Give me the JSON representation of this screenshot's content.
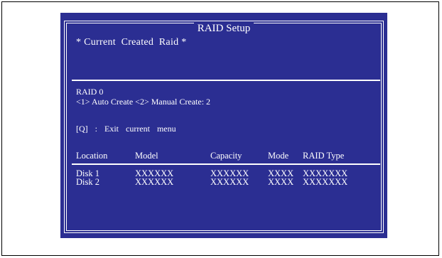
{
  "window": {
    "title": "RAID Setup",
    "subtitle": "* Current  Created  Raid *"
  },
  "raid": {
    "level": "RAID 0",
    "create_options": "<1> Auto Create <2> Manual Create: 2",
    "exit_hint": "[Q]  :  Exit  current  menu"
  },
  "disk_table": {
    "columns": [
      "Location",
      "Model",
      "Capacity",
      "Mode",
      "RAID Type"
    ],
    "rows": [
      [
        "Disk 1",
        "XXXXXX",
        "XXXXXX",
        "XXXX",
        "XXXXXXX"
      ],
      [
        "Disk 2",
        "XXXXXX",
        "XXXXXX",
        "XXXX",
        "XXXXXXX"
      ]
    ]
  },
  "colors": {
    "screen_background": "#2b2e92",
    "text": "#ffffff"
  }
}
